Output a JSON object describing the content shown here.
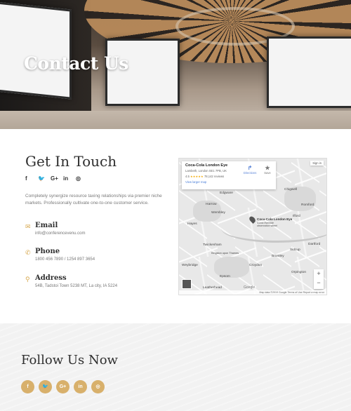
{
  "hero": {
    "title": "Contact Us"
  },
  "contact": {
    "title": "Get In Touch",
    "social_icons": [
      "f",
      "🐦",
      "G+",
      "in",
      "◎"
    ],
    "description": "Completely synergize resource taxing relationships via premier niche markets. Professionally cultivate one-to-one customer service.",
    "email": {
      "label": "Email",
      "value": "info@conferencevenu.com",
      "icon": "envelope-icon"
    },
    "phone": {
      "label": "Phone",
      "value": "1800 456 7890 / 1254 897 3654",
      "icon": "phone-icon"
    },
    "address": {
      "label": "Address",
      "value": "54B, Tadstoi Town 5238 MT, La city, IA 5224",
      "icon": "map-pin-icon"
    }
  },
  "map": {
    "place_title": "Coca-Cola London Eye",
    "place_address": "Lambeth, London SE1 7PB, UK",
    "rating": "4.5",
    "stars": "★★★★★",
    "reviews": "78,142 reviews",
    "view_larger": "View larger map",
    "directions": "Directions",
    "save": "Save",
    "sign_in": "Sign in",
    "pin_label": "Coca-Cola London Eye",
    "pin_sub": "Iconic riverside observation wheel",
    "places": [
      "Edgware",
      "Harrow",
      "Wembley",
      "Chigwell",
      "Romford",
      "Ilford",
      "Hayes",
      "Twickenham",
      "Croydon",
      "Bromley",
      "Dartford",
      "Epsom",
      "Leatherhead",
      "Weybridge",
      "Sidcup",
      "Orpington",
      "Kingston upon Thames"
    ],
    "footer": "Map data ©2019 Google   Terms of Use   Report a map error",
    "google": "Google",
    "zoom_in": "+",
    "zoom_out": "−"
  },
  "follow": {
    "title": "Follow Us Now",
    "icons": [
      "f",
      "🐦",
      "G+",
      "in",
      "◎"
    ]
  }
}
